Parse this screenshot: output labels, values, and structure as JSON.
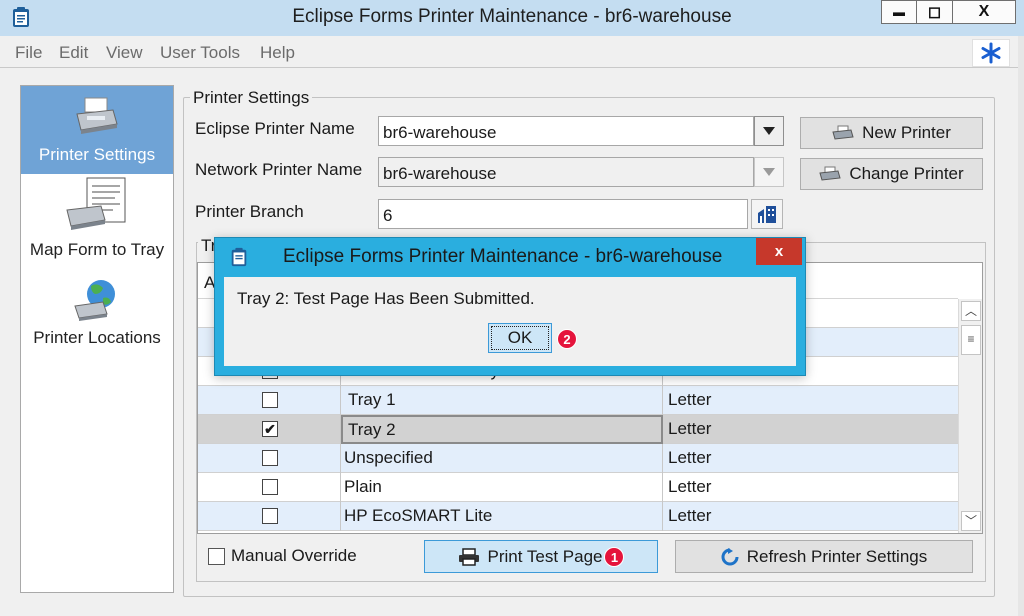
{
  "window": {
    "title": "Eclipse Forms Printer Maintenance - br6-warehouse",
    "minimize_glyph": "▬",
    "maximize_glyph": "◻",
    "close_glyph": "X"
  },
  "menu": [
    "File",
    "Edit",
    "View",
    "User Tools",
    "Help"
  ],
  "help_icon": "asterisk-help-icon",
  "nav": {
    "items": [
      {
        "label": "Printer Settings",
        "icon": "printer-icon",
        "selected": true
      },
      {
        "label": "Map Form to Tray",
        "icon": "printer-form-icon",
        "selected": false
      },
      {
        "label": "Printer Locations",
        "icon": "globe-printer-icon",
        "selected": false
      }
    ]
  },
  "settings": {
    "group_title": "Printer Settings",
    "eclipse_printer_name": {
      "label": "Eclipse Printer Name",
      "value": "br6-warehouse"
    },
    "network_printer_name": {
      "label": "Network Printer Name",
      "value": "br6-warehouse"
    },
    "printer_branch": {
      "label": "Printer Branch",
      "value": "6"
    },
    "new_printer_label": "New Printer",
    "change_printer_label": "Change Printer"
  },
  "trays": {
    "group_title_fragment": "Tr",
    "header_fragment": "A",
    "rows": [
      {
        "name": "Manual Feed in Tray 1",
        "type": "Letter",
        "checked": false
      },
      {
        "name": "Tray 1",
        "type": "Letter",
        "checked": false
      },
      {
        "name": "Tray 2",
        "type": "Letter",
        "checked": true
      },
      {
        "name": "Unspecified",
        "type": "Letter",
        "checked": false
      },
      {
        "name": "Plain",
        "type": "Letter",
        "checked": false
      },
      {
        "name": "HP EcoSMART Lite",
        "type": "Letter",
        "checked": false
      }
    ]
  },
  "bottom": {
    "manual_override_label": "Manual Override",
    "print_test_page_label": "Print Test Page",
    "print_badge": "1",
    "refresh_label": "Refresh Printer Settings"
  },
  "dialog": {
    "title": "Eclipse Forms Printer Maintenance - br6-warehouse",
    "message": "Tray 2: Test Page Has Been Submitted.",
    "ok_label": "OK",
    "ok_badge": "2",
    "close_glyph": "x"
  },
  "colors": {
    "titlebar": "#c4ddf1",
    "nav_selected": "#6fa3d6",
    "dialog_frame": "#2aaedf",
    "badge": "#e5143c",
    "dialog_close": "#c6382b"
  }
}
